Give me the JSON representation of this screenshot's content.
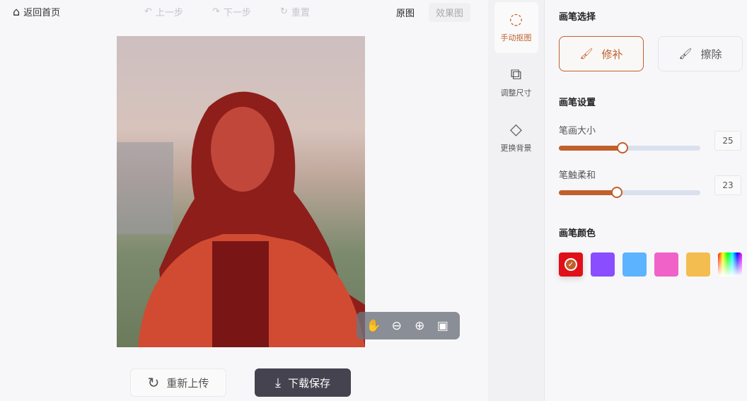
{
  "header": {
    "home": "返回首页",
    "undo": "上一步",
    "redo": "下一步",
    "reset": "重置",
    "tab_original": "原图",
    "tab_result": "效果图"
  },
  "canvas": {
    "zoom_tools": [
      "hand-icon",
      "zoom-out-icon",
      "zoom-in-icon",
      "actual-size-icon"
    ]
  },
  "footer": {
    "reupload": "重新上传",
    "download": "下载保存"
  },
  "tools": [
    {
      "label": "手动抠图",
      "active": true
    },
    {
      "label": "调整尺寸"
    },
    {
      "label": "更换背景"
    }
  ],
  "panel": {
    "brush_select_title": "画笔选择",
    "repair": "修补",
    "erase": "擦除",
    "brush_settings_title": "画笔设置",
    "size_label": "笔画大小",
    "size_value": "25",
    "size_percent": 45,
    "soft_label": "笔触柔和",
    "soft_value": "23",
    "soft_percent": 41,
    "color_title": "画笔颜色",
    "colors": [
      "#e01018",
      "#8a4dff",
      "#5cb3ff",
      "#f062c8",
      "#f4bd50"
    ],
    "accent": "#c0602c"
  }
}
